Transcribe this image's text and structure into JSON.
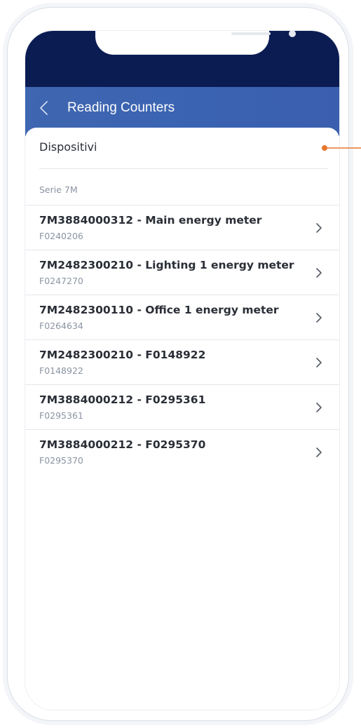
{
  "header": {
    "title": "Reading Counters"
  },
  "section": {
    "title": "Dispositivi",
    "group_label": "Serie 7M"
  },
  "devices": [
    {
      "name": "7M3884000312 - Main energy meter",
      "code": "F0240206"
    },
    {
      "name": "7M2482300210 - Lighting 1 energy meter",
      "code": "F0247270"
    },
    {
      "name": "7M2482300110 - Office 1 energy meter",
      "code": "F0264634"
    },
    {
      "name": "7M2482300210 - F0148922",
      "code": "F0148922"
    },
    {
      "name": "7M3884000212 - F0295361",
      "code": "F0295361"
    },
    {
      "name": "7M3884000212 - F0295370",
      "code": "F0295370"
    }
  ],
  "colors": {
    "status_bar": "#0b1c52",
    "header_bar": "#3f66b0",
    "annotation_marker": "#e8772e"
  },
  "icons": {
    "back": "chevron-left-icon",
    "row": "chevron-right-icon"
  }
}
